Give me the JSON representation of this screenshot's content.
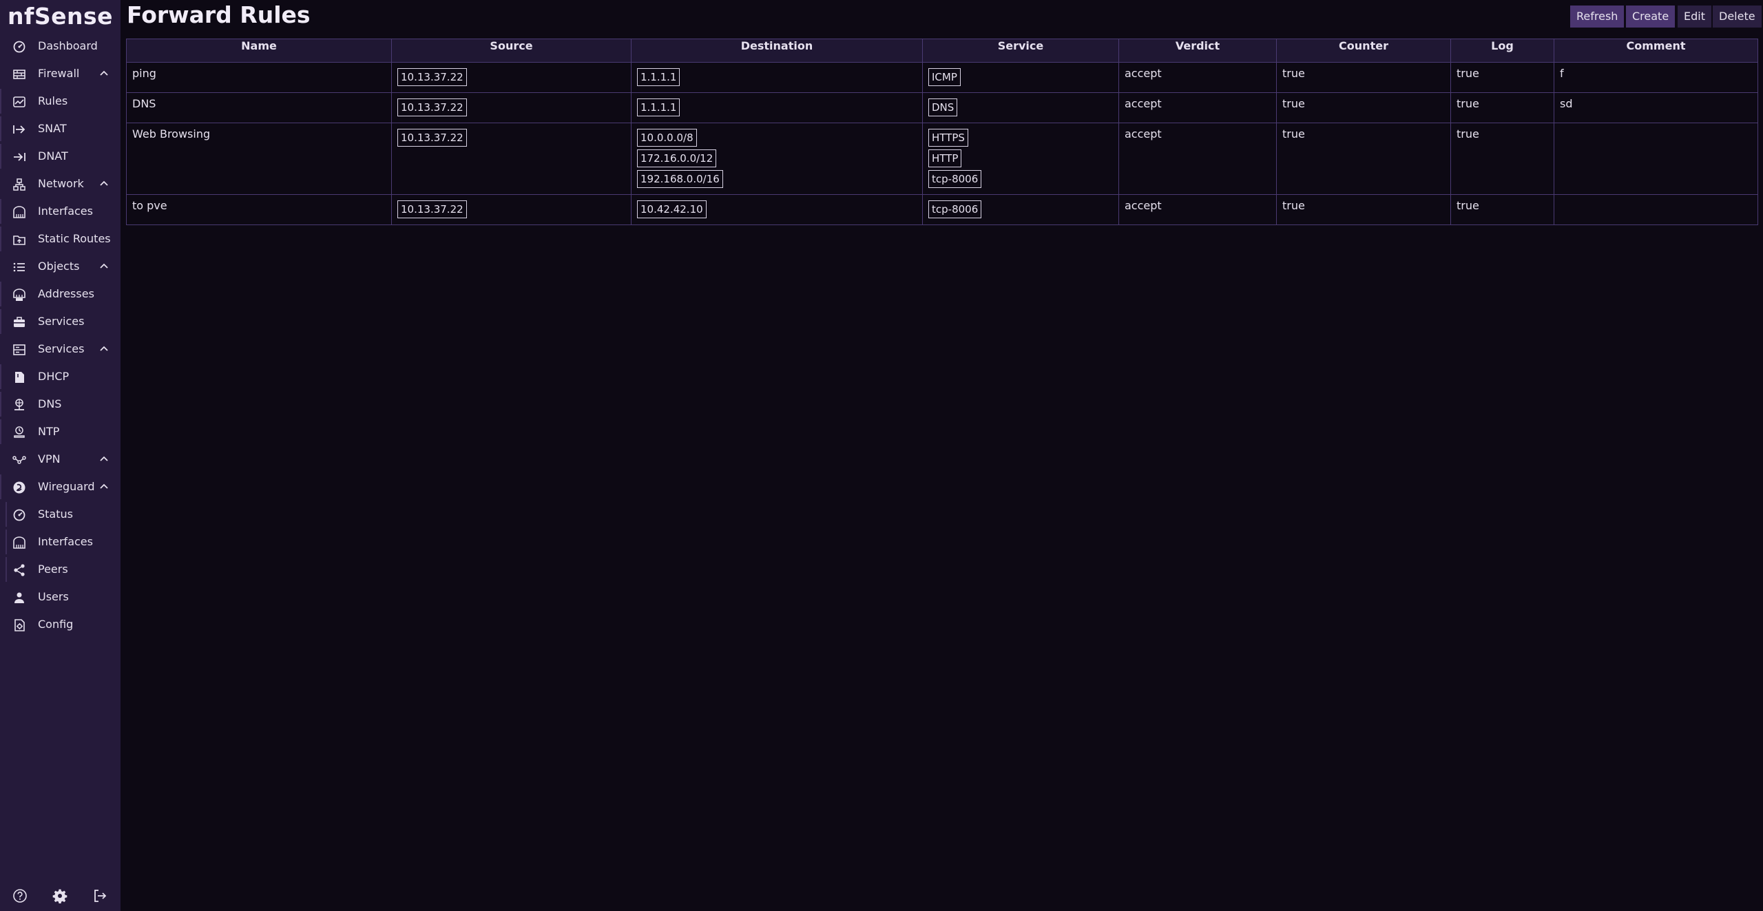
{
  "app": {
    "brand": "nfSense",
    "page_title": "Forward Rules"
  },
  "sidebar": {
    "items": [
      {
        "label": "Dashboard",
        "icon": "dashboard-icon"
      },
      {
        "label": "Firewall",
        "icon": "firewall-icon",
        "expanded": true
      },
      {
        "label": "Rules",
        "icon": "rules-icon"
      },
      {
        "label": "SNAT",
        "icon": "snat-icon"
      },
      {
        "label": "DNAT",
        "icon": "dnat-icon"
      },
      {
        "label": "Network",
        "icon": "network-icon",
        "expanded": true
      },
      {
        "label": "Interfaces",
        "icon": "interfaces-icon"
      },
      {
        "label": "Static Routes",
        "icon": "static-routes-icon"
      },
      {
        "label": "Objects",
        "icon": "objects-icon",
        "expanded": true
      },
      {
        "label": "Addresses",
        "icon": "addresses-icon"
      },
      {
        "label": "Services",
        "icon": "services-icon"
      },
      {
        "label": "Services",
        "icon": "services-group-icon",
        "expanded": true
      },
      {
        "label": "DHCP",
        "icon": "dhcp-icon"
      },
      {
        "label": "DNS",
        "icon": "dns-icon"
      },
      {
        "label": "NTP",
        "icon": "ntp-icon"
      },
      {
        "label": "VPN",
        "icon": "vpn-icon",
        "expanded": true
      },
      {
        "label": "Wireguard",
        "icon": "wireguard-icon",
        "expanded": true
      },
      {
        "label": "Status",
        "icon": "status-icon"
      },
      {
        "label": "Interfaces",
        "icon": "wg-interfaces-icon"
      },
      {
        "label": "Peers",
        "icon": "peers-icon"
      },
      {
        "label": "Users",
        "icon": "users-icon"
      },
      {
        "label": "Config",
        "icon": "config-icon"
      }
    ],
    "bottom_icons": [
      "help-icon",
      "settings-icon",
      "logout-icon"
    ]
  },
  "toolbar": {
    "refresh_label": "Refresh",
    "create_label": "Create",
    "edit_label": "Edit",
    "delete_label": "Delete"
  },
  "table": {
    "columns": [
      "Name",
      "Source",
      "Destination",
      "Service",
      "Verdict",
      "Counter",
      "Log",
      "Comment"
    ],
    "rows": [
      {
        "name": "ping",
        "source": [
          "10.13.37.22"
        ],
        "destination": [
          "1.1.1.1"
        ],
        "service": [
          "ICMP"
        ],
        "verdict": "accept",
        "counter": "true",
        "log": "true",
        "comment": "f"
      },
      {
        "name": "DNS",
        "source": [
          "10.13.37.22"
        ],
        "destination": [
          "1.1.1.1"
        ],
        "service": [
          "DNS"
        ],
        "verdict": "accept",
        "counter": "true",
        "log": "true",
        "comment": "sd"
      },
      {
        "name": "Web Browsing",
        "source": [
          "10.13.37.22"
        ],
        "destination": [
          "10.0.0.0/8",
          "172.16.0.0/12",
          "192.168.0.0/16"
        ],
        "service": [
          "HTTPS",
          "HTTP",
          "tcp-8006"
        ],
        "verdict": "accept",
        "counter": "true",
        "log": "true",
        "comment": ""
      },
      {
        "name": "to pve",
        "source": [
          "10.13.37.22"
        ],
        "destination": [
          "10.42.42.10"
        ],
        "service": [
          "tcp-8006"
        ],
        "verdict": "accept",
        "counter": "true",
        "log": "true",
        "comment": ""
      }
    ]
  },
  "colors": {
    "sidebar_bg": "#251a3a",
    "main_bg": "#0d0914",
    "primary_button": "#4a3570",
    "secondary_button": "#2a1f40",
    "table_border": "#4a3a72"
  }
}
